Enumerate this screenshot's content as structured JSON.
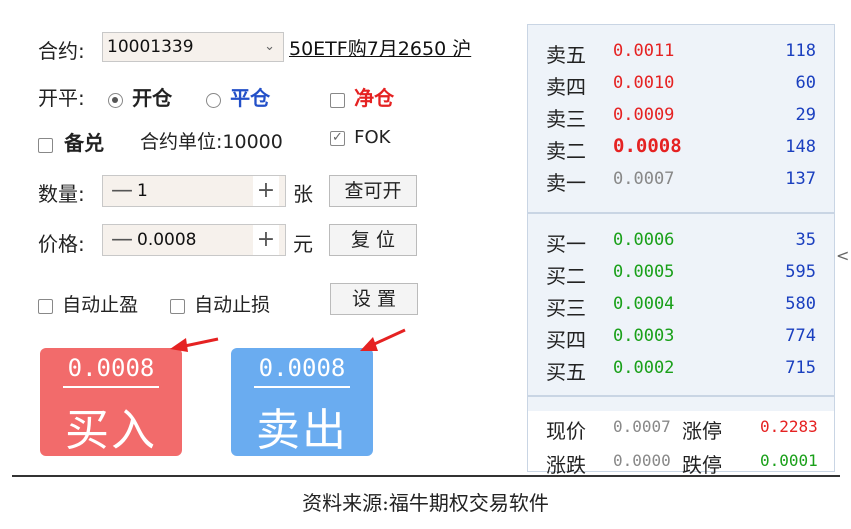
{
  "form": {
    "contract_label": "合约:",
    "contract_code": "10001339",
    "contract_name": "50ETF购7月2650 沪",
    "open_close_label": "开平:",
    "open_label": "开仓",
    "close_label": "平仓",
    "net_label": "净仓",
    "covered_label": "备兑",
    "unit_text": "合约单位:10000",
    "fok_label": "FOK",
    "qty_label": "数量:",
    "qty_value": "1",
    "qty_unit": "张",
    "check_btn": "查可开",
    "price_label": "价格:",
    "price_value": "0.0008",
    "price_unit": "元",
    "reset_btn": "复 位",
    "auto_tp": "自动止盈",
    "auto_sl": "自动止损",
    "settings_btn": "设 置"
  },
  "trade": {
    "buy_price": "0.0008",
    "buy_label": "买入",
    "sell_price": "0.0008",
    "sell_label": "卖出",
    "buy_color": "#f26b6b",
    "sell_color": "#6aacf0"
  },
  "book": {
    "asks": [
      {
        "name": "卖五",
        "price": "0.0011",
        "qty": "118"
      },
      {
        "name": "卖四",
        "price": "0.0010",
        "qty": "60"
      },
      {
        "name": "卖三",
        "price": "0.0009",
        "qty": "29"
      },
      {
        "name": "卖二",
        "price": "0.0008",
        "qty": "148"
      },
      {
        "name": "卖一",
        "price": "0.0007",
        "qty": "137"
      }
    ],
    "bids": [
      {
        "name": "买一",
        "price": "0.0006",
        "qty": "35"
      },
      {
        "name": "买二",
        "price": "0.0005",
        "qty": "595"
      },
      {
        "name": "买三",
        "price": "0.0004",
        "qty": "580"
      },
      {
        "name": "买四",
        "price": "0.0003",
        "qty": "774"
      },
      {
        "name": "买五",
        "price": "0.0002",
        "qty": "715"
      }
    ],
    "last_label": "现价",
    "last_value": "0.0007",
    "limit_up_label": "涨停",
    "limit_up_value": "0.2283",
    "change_label": "涨跌",
    "change_value": "0.0000",
    "limit_down_label": "跌停",
    "limit_down_value": "0.0001",
    "collapse_glyph": "<"
  },
  "caption": "资料来源:福牛期权交易软件",
  "arrow_color": "#e52222"
}
